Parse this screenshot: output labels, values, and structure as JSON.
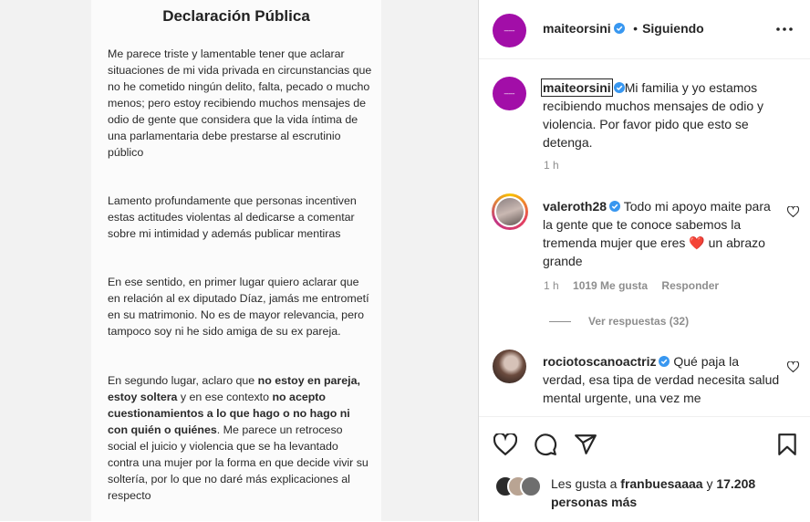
{
  "document": {
    "title": "Declaración Pública",
    "paragraphs": [
      "Me parece triste y lamentable tener que aclarar situaciones de mi vida privada en circunstancias que no he cometido ningún delito, falta, pecado o mucho menos; pero estoy recibiendo muchos mensajes de odio de gente que considera que la vida íntima de una parlamentaria debe prestarse al escrutinio público",
      "Lamento profundamente que personas incentiven estas actitudes violentas al dedicarse a comentar sobre mi intimidad y además publicar mentiras",
      "En ese sentido, en primer lugar quiero aclarar que en relación al ex diputado Díaz, jamás me entrometí en su matrimonio. No es de mayor relevancia, pero tampoco soy ni he sido amiga de su ex pareja."
    ],
    "p4": {
      "a": "En segundo lugar, aclaro que ",
      "b": "no estoy en pareja, estoy soltera",
      "c": " y en ese contexto ",
      "d": "no acepto cuestionamientos a lo que hago o no hago ni con quién o quiénes",
      "e": ". Me parece un retroceso social el juicio y violencia que se ha levantado contra una mujer por la forma en que decide vivir su soltería, por lo que no daré más explicaciones al respecto"
    }
  },
  "header": {
    "username": "maiteorsini",
    "separator": "•",
    "follow_status": "Siguiendo",
    "more_icon": "more-horizontal-icon"
  },
  "caption": {
    "username": "maiteorsini",
    "text": "Mi familia y yo estamos recibiendo muchos mensajes de odio y violencia. Por favor pido que esto se detenga.",
    "time": "1 h"
  },
  "comments": [
    {
      "username": "valeroth28",
      "text_before": "Todo mi apoyo maite para la gente que te conoce sabemos la tremenda mujer que eres",
      "emoji": "❤️",
      "text_after": "un abrazo grande",
      "time": "1 h",
      "likes": "1019 Me gusta",
      "reply": "Responder",
      "view_replies": "Ver respuestas (32)"
    },
    {
      "username": "rociotoscanoactriz",
      "text": "Qué paja la verdad, esa tipa de verdad necesita salud mental urgente, una vez me",
      "time": "",
      "likes": "",
      "reply": ""
    }
  ],
  "likes": {
    "prefix": "Les gusta a",
    "user": "franbuesaaaa",
    "conjunction": "y",
    "count_text": "17.208 personas más"
  },
  "colors": {
    "brand_avatar": "#a20ea8",
    "verified": "#3897f0",
    "heart": "#ed4956",
    "muted": "#8e8e8e",
    "text": "#262626"
  }
}
